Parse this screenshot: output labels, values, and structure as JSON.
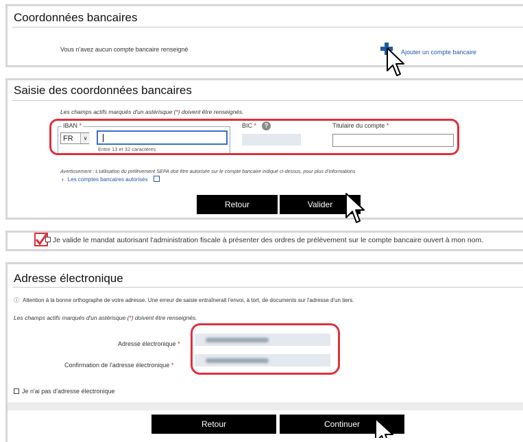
{
  "bank": {
    "title": "Coordonnées bancaires",
    "no_account_text": "Vous n'avez aucun compte bancaire renseigné",
    "add_link": "Ajouter un compte bancaire"
  },
  "entry": {
    "title": "Saisie des coordonnées bancaires",
    "required_note_prefix": "Les champs actifs marqués d'un astérisque (",
    "required_note_star": "*",
    "required_note_suffix": ") doivent être renseignés.",
    "iban_label": "IBAN",
    "iban_country": "FR",
    "iban_value": "",
    "iban_hint": "Entre 13 et 32 caractères",
    "bic_label": "BIC",
    "bic_help": "?",
    "holder_label": "Titulaire du compte",
    "star": "*",
    "warning": "Avertissement : L'utilisation du prélèvement SEPA doit être autorisée sur le compte bancaire indiqué ci-dessus, pour plus d'informations",
    "authorized_link": "Les comptes bancaires autorisés",
    "back_button": "Retour",
    "validate_button": "Valider"
  },
  "mandate": {
    "text": "Je valide le mandat autorisant l'administration fiscale à présenter des ordres de prélèvement sur le compte bancaire ouvert à mon nom.",
    "checked": true
  },
  "email": {
    "title": "Adresse électronique",
    "info_icon": "ⓘ",
    "info_text": "Attention à la bonne orthographe de votre adresse. Une erreur de saisie entraînerait l'envoi, à tort, de documents sur l'adresse d'un tiers.",
    "required_note_prefix": "Les champs actifs marqués d'un astérisque (",
    "required_note_star": "*",
    "required_note_suffix": ") doivent être renseignés.",
    "address_label": "Adresse électronique",
    "confirm_label": "Confirmation de l'adresse électronique",
    "star": "*",
    "no_address_label": "Je n'ai pas d'adresse électronique",
    "back_button": "Retour",
    "continue_button": "Continuer"
  },
  "colors": {
    "accent_blue": "#1f5aa8",
    "annotation_red": "#e0303a",
    "button_black": "#000000"
  }
}
